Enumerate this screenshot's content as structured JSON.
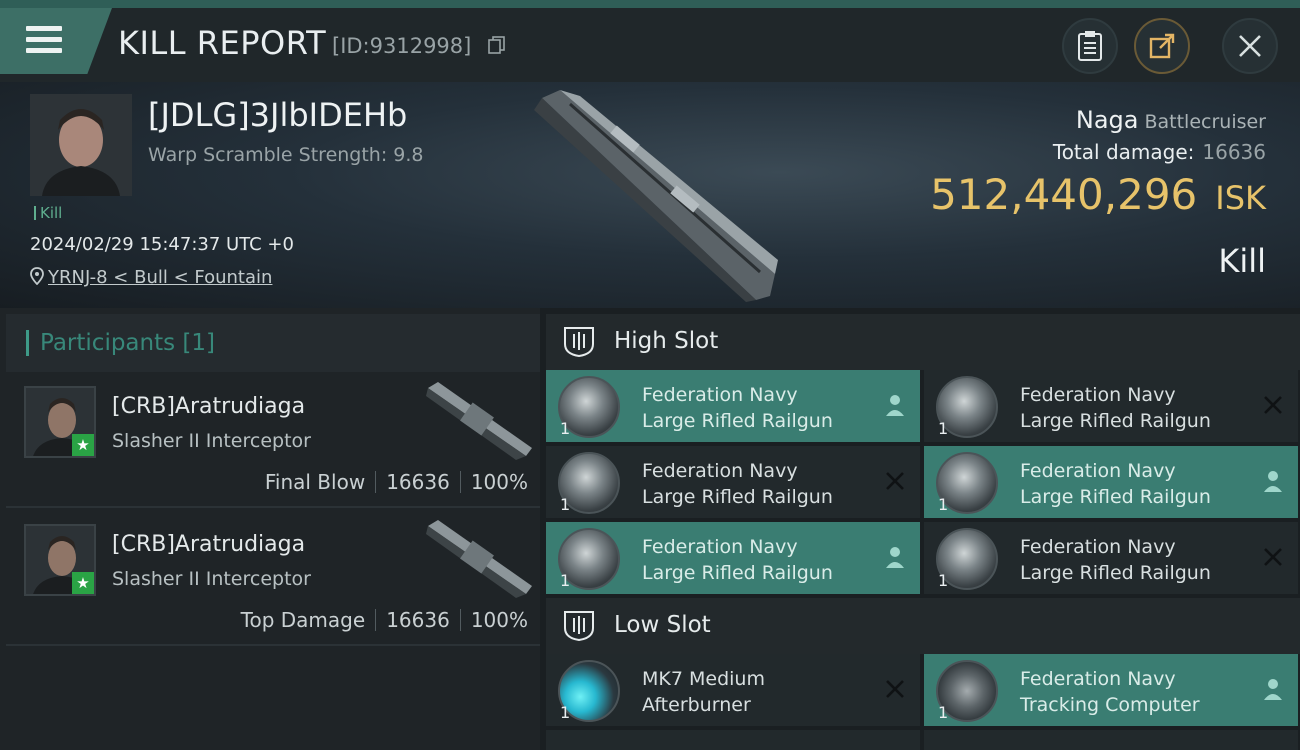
{
  "header": {
    "title": "KILL REPORT",
    "report_id": "[ID:9312998]"
  },
  "victim": {
    "name": "[JDLG]3JlbIDEHb",
    "scramble": "Warp Scramble Strength: 9.8",
    "kill_tag": "Kill",
    "datetime": "2024/02/29 15:47:37 UTC +0",
    "location": "YRNJ-8 < Bull < Fountain",
    "ship_name": "Naga",
    "ship_class": "Battlecruiser",
    "total_damage_label": "Total damage:",
    "total_damage": "16636",
    "isk_value": "512,440,296",
    "isk_unit": "ISK",
    "result": "Kill"
  },
  "participants": {
    "title": "Participants [1]",
    "rows": [
      {
        "name": "[CRB]Aratrudiaga",
        "ship": "Slasher II Interceptor",
        "role": "Final Blow",
        "damage": "16636",
        "percent": "100%"
      },
      {
        "name": "[CRB]Aratrudiaga",
        "ship": "Slasher II Interceptor",
        "role": "Top Damage",
        "damage": "16636",
        "percent": "100%"
      }
    ]
  },
  "fitting": {
    "high_slot_label": "High Slot",
    "low_slot_label": "Low Slot",
    "high_slots": [
      {
        "line1": "Federation Navy",
        "line2": "Large Rifled Railgun",
        "qty": "1",
        "active": true
      },
      {
        "line1": "Federation Navy",
        "line2": "Large Rifled Railgun",
        "qty": "1",
        "active": false
      },
      {
        "line1": "Federation Navy",
        "line2": "Large Rifled Railgun",
        "qty": "1",
        "active": false
      },
      {
        "line1": "Federation Navy",
        "line2": "Large Rifled Railgun",
        "qty": "1",
        "active": true
      },
      {
        "line1": "Federation Navy",
        "line2": "Large Rifled Railgun",
        "qty": "1",
        "active": true
      },
      {
        "line1": "Federation Navy",
        "line2": "Large Rifled Railgun",
        "qty": "1",
        "active": false
      }
    ],
    "low_slots": [
      {
        "line1": "MK7 Medium",
        "line2": "Afterburner",
        "qty": "1",
        "active": false
      },
      {
        "line1": "Federation Navy",
        "line2": "Tracking Computer",
        "qty": "1",
        "active": true
      }
    ]
  },
  "colors": {
    "accent_teal": "#3a7d72",
    "isk_gold": "#e7c36a",
    "star_green": "#2aa345"
  }
}
